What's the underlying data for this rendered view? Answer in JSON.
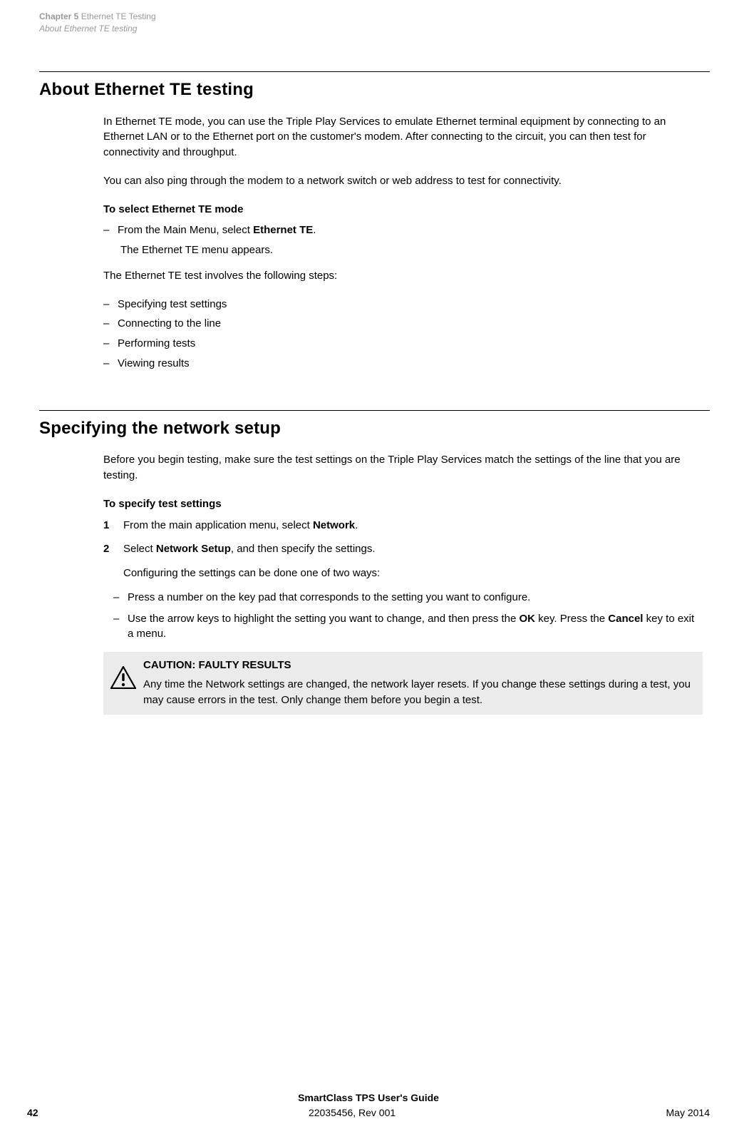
{
  "header": {
    "chapter_prefix": "Chapter 5",
    "chapter_title": "Ethernet TE Testing",
    "section_title": "About Ethernet TE testing"
  },
  "section1": {
    "heading": "About Ethernet TE testing",
    "para1": "In Ethernet TE mode, you can use the Triple Play Services to emulate Ethernet terminal equipment by connecting to an Ethernet LAN or to the Ethernet port on the customer's modem. After connecting to the circuit, you can then test for connectivity and throughput.",
    "para2": "You can also ping through the modem to a network switch or web address to test for connectivity.",
    "subhead1": "To select Ethernet TE mode",
    "step1_pre": "From the Main Menu, select ",
    "step1_bold": "Ethernet TE",
    "step1_post": ".",
    "step1_result": "The Ethernet TE menu appears.",
    "para3": "The Ethernet TE test involves the following steps:",
    "bullets": [
      "Specifying test settings",
      "Connecting to the line",
      "Performing tests",
      "Viewing results"
    ]
  },
  "section2": {
    "heading": "Specifying the network setup",
    "para1": "Before you begin testing, make sure the test settings on the Triple Play Services match the settings of the line that you are testing.",
    "subhead1": "To specify test settings",
    "step1_pre": "From the main application menu, select ",
    "step1_bold": "Network",
    "step1_post": ".",
    "step2_pre": "Select ",
    "step2_bold": "Network Setup",
    "step2_post": ", and then specify the settings.",
    "step2_sub": "Configuring the settings can be done one of two ways:",
    "nested1": "Press a number on the key pad that corresponds to the setting you want to configure.",
    "nested2_pre": "Use the arrow keys to highlight the setting you want to change, and then press the ",
    "nested2_bold1": "OK",
    "nested2_mid": " key. Press the ",
    "nested2_bold2": "Cancel",
    "nested2_post": " key to exit a menu."
  },
  "caution": {
    "title": "CAUTION: FAULTY RESULTS",
    "body": "Any time the Network settings are changed, the network layer resets. If you change these settings during a test, you may cause errors in the test. Only change them before you begin a test."
  },
  "footer": {
    "guide": "SmartClass TPS User's Guide",
    "docnum": "22035456, Rev 001",
    "page": "42",
    "date": "May 2014"
  }
}
